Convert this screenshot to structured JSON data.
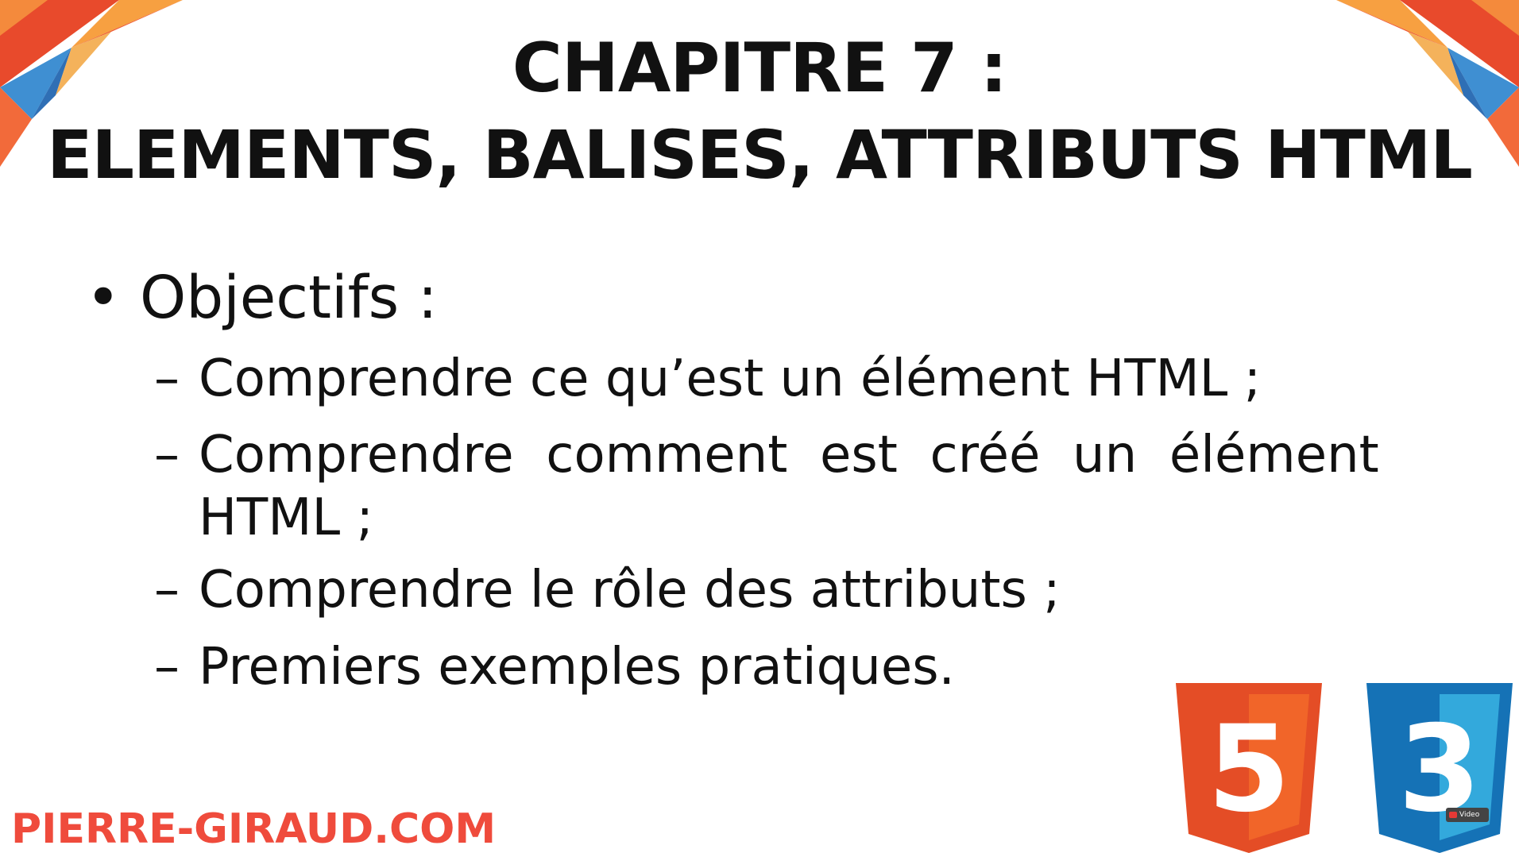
{
  "slide": {
    "title_line1": "CHAPITRE 7 :",
    "title_line2": "ELEMENTS, BALISES, ATTRIBUTS HTML",
    "main_bullet": {
      "marker": "•",
      "label": "Objectifs :"
    },
    "sub_bullets": {
      "marker": "–",
      "items": [
        "Comprendre ce qu’est un élément HTML ;",
        "Comprendre  comment  est  créé  un  élément",
        "HTML ;",
        "Comprendre le rôle des attributs ;",
        "Premiers exemples pratiques."
      ]
    },
    "footer_brand": "PIERRE-GIRAUD.COM",
    "html5_number": "5",
    "css3_number": "3",
    "badge_label": "Video"
  },
  "colors": {
    "title": "#111111",
    "brand": "#ef4b3c",
    "html5_orange": "#e44d26",
    "html5_light": "#f16529",
    "css3_blue": "#1572b6",
    "css3_light": "#33a9dc"
  },
  "icons": [
    "html5-logo-icon",
    "css3-logo-icon",
    "corner-triangles-decoration"
  ]
}
